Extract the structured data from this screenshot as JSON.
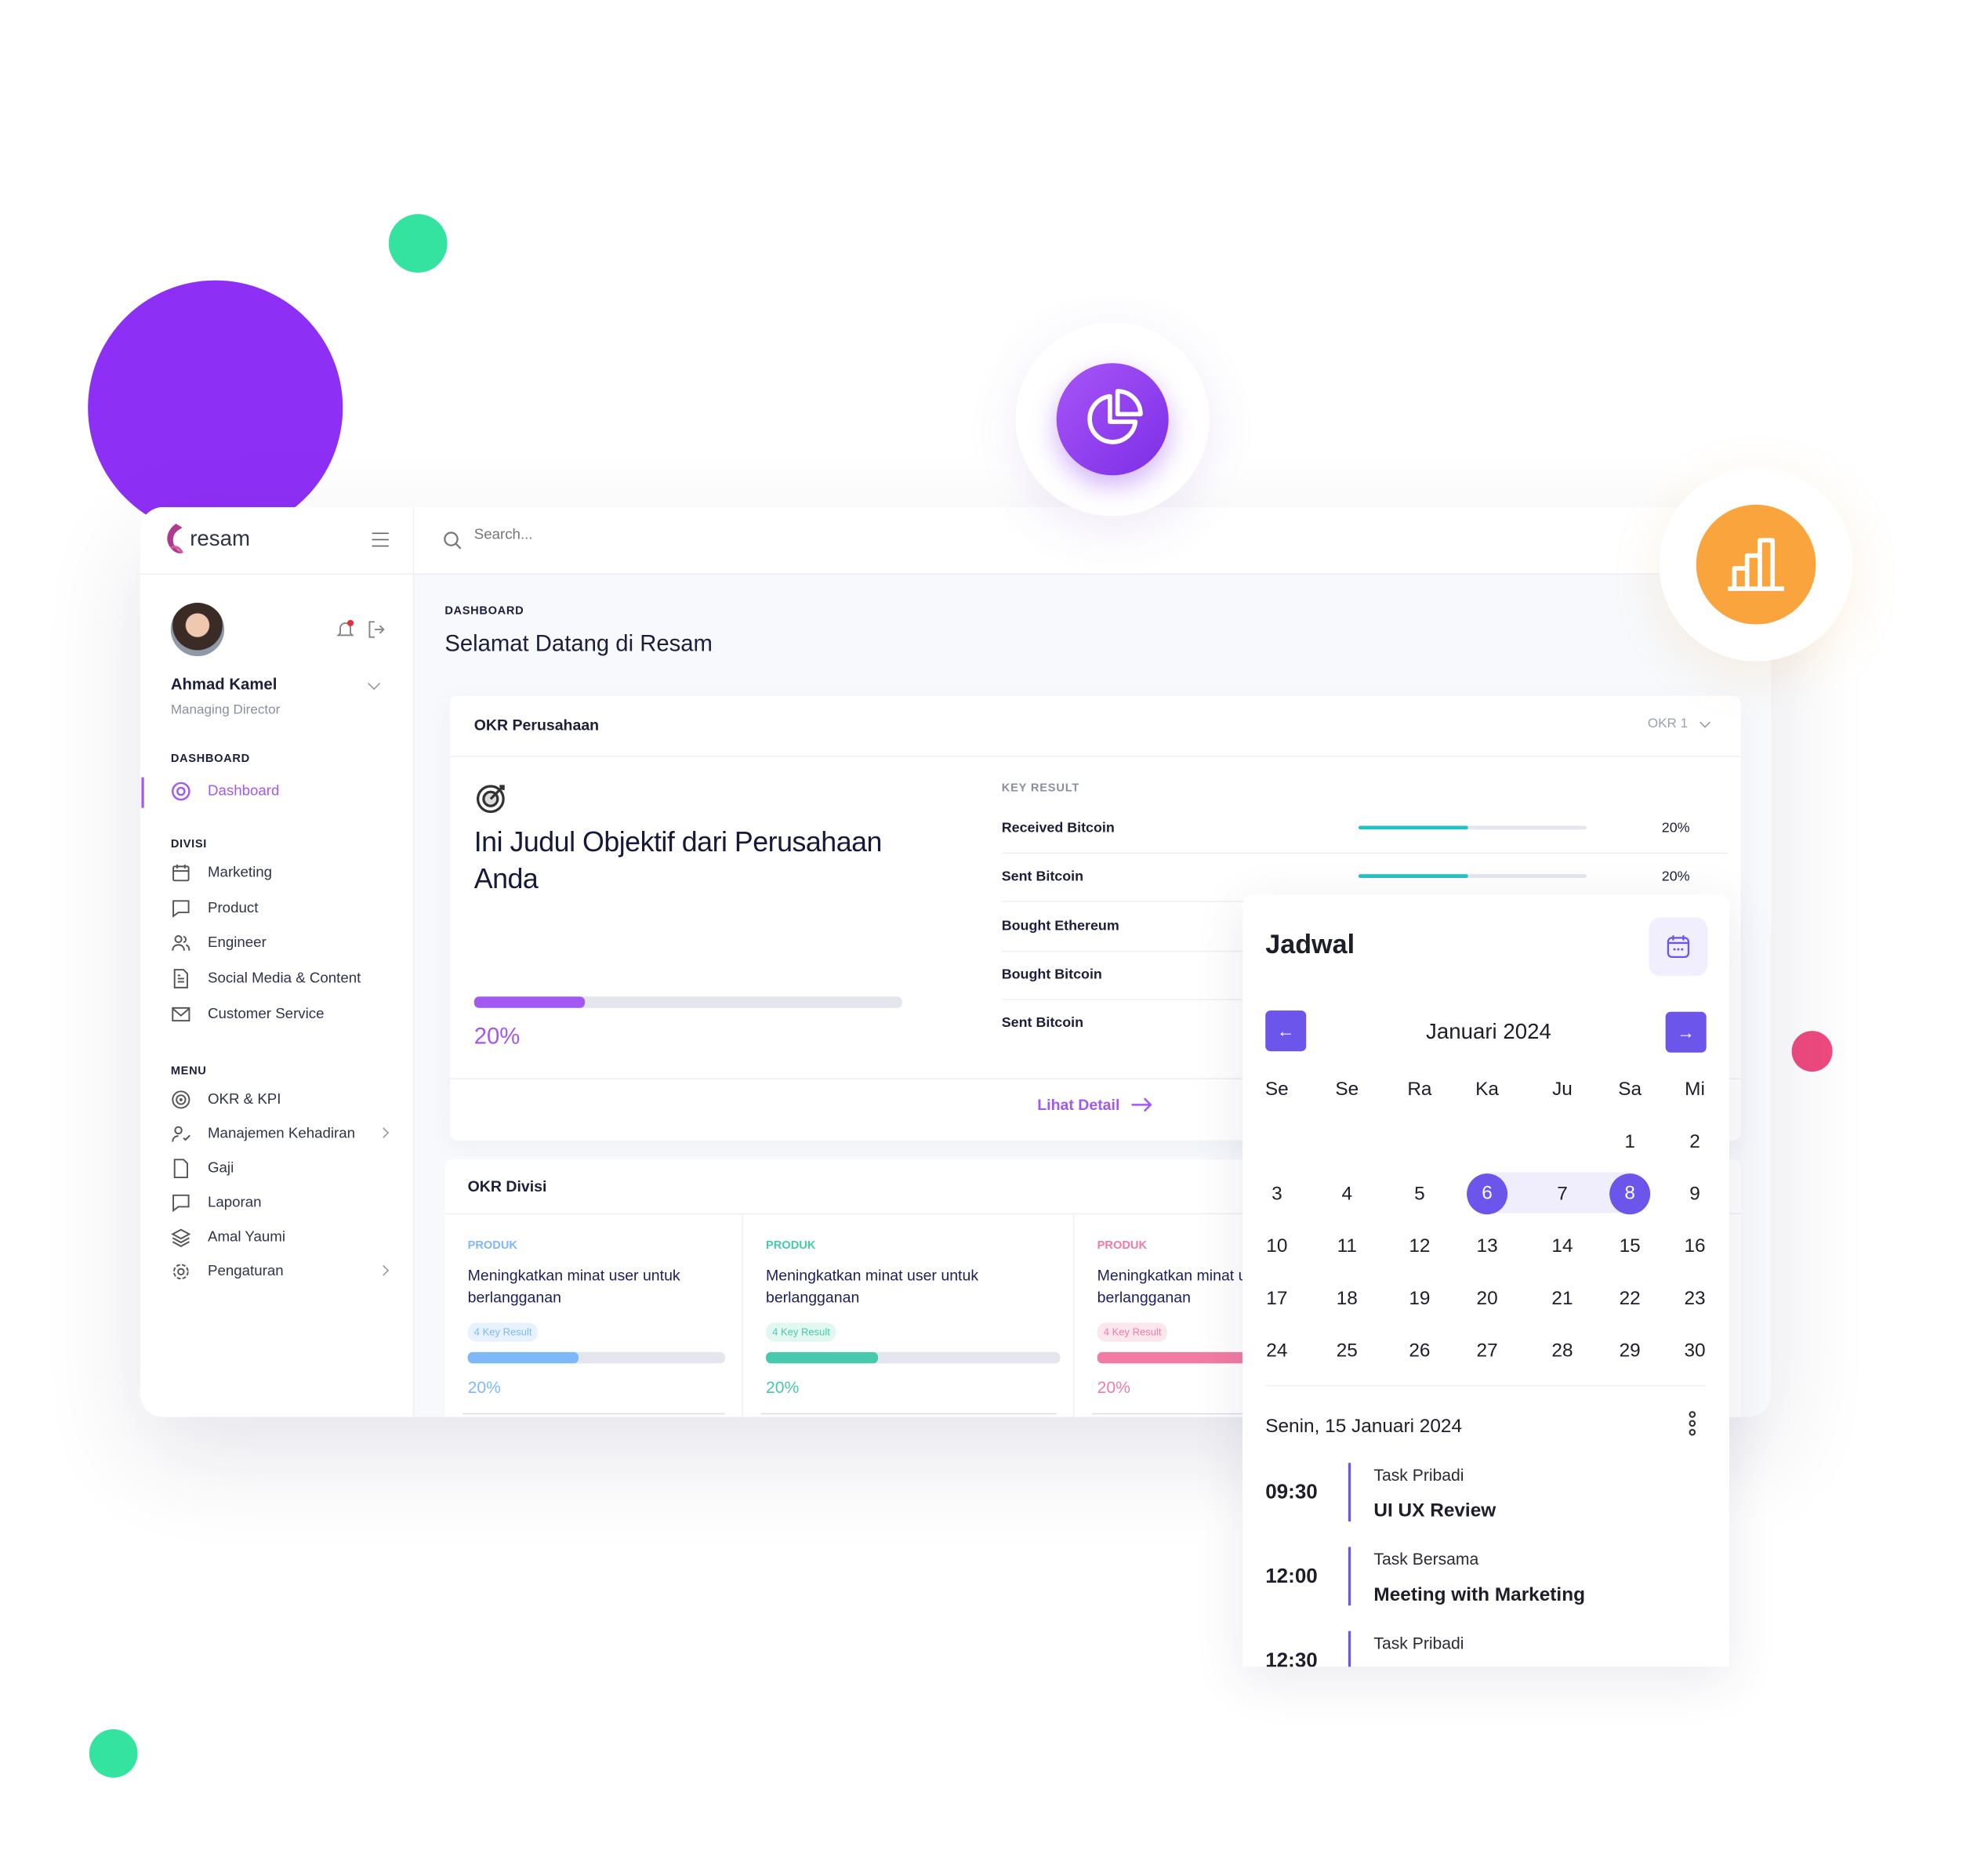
{
  "colors": {
    "purple": "#8e2ff5",
    "green": "#34e3a0",
    "pink": "#ef4a7f",
    "orange": "#f9a43d",
    "accent": "#6b55ea",
    "brand": "#a259f0"
  },
  "header": {
    "logo": "resam",
    "search_placeholder": "Search..."
  },
  "user": {
    "name": "Ahmad Kamel",
    "role": "Managing Director"
  },
  "sidebar": {
    "dashboard_section": "DASHBOARD",
    "dashboard_item": "Dashboard",
    "divisi_section": "DIVISI",
    "divisi": [
      {
        "label": "Marketing",
        "icon": "calendar-icon"
      },
      {
        "label": "Product",
        "icon": "chat-icon"
      },
      {
        "label": "Engineer",
        "icon": "users-icon"
      },
      {
        "label": "Social Media & Content",
        "icon": "document-icon"
      },
      {
        "label": "Customer Service",
        "icon": "mail-icon"
      }
    ],
    "menu_section": "MENU",
    "menu": [
      {
        "label": "OKR & KPI",
        "icon": "target-icon"
      },
      {
        "label": "Manajemen Kehadiran",
        "icon": "user-check-icon",
        "chevron": true
      },
      {
        "label": "Gaji",
        "icon": "file-icon"
      },
      {
        "label": "Laporan",
        "icon": "chat-icon"
      },
      {
        "label": "Amal Yaumi",
        "icon": "layers-icon"
      },
      {
        "label": "Pengaturan",
        "icon": "gear-icon",
        "chevron": true
      }
    ]
  },
  "page": {
    "breadcrumb": "DASHBOARD",
    "title": "Selamat Datang di Resam"
  },
  "okr_company": {
    "title": "OKR Perusahaan",
    "selector": "OKR 1",
    "objective": "Ini Judul Objektif dari Perusahaan Anda",
    "progress_label": "20%",
    "progress_fill": 0.26,
    "key_result_header": "KEY RESULT",
    "key_results": [
      {
        "label": "Received Bitcoin",
        "percent": "20%",
        "fill": 0.48
      },
      {
        "label": "Sent Bitcoin",
        "percent": "20%",
        "fill": 0.48
      },
      {
        "label": "Bought Ethereum"
      },
      {
        "label": "Bought Bitcoin"
      },
      {
        "label": "Sent Bitcoin"
      }
    ],
    "detail_link": "Lihat Detail"
  },
  "okr_division": {
    "title": "OKR Divisi",
    "cards": [
      {
        "tag": "PRODUK",
        "title": "Meningkatkan minat user untuk berlangganan",
        "badge": "4 Key Result",
        "percent": "20%",
        "fill": 0.43,
        "color": "#7db8fb",
        "bg": "#e8f2fe"
      },
      {
        "tag": "PRODUK",
        "title": "Meningkatkan minat user untuk berlangganan",
        "badge": "4 Key Result",
        "percent": "20%",
        "fill": 0.38,
        "color": "#46c9ac",
        "bg": "#e3f7f1"
      },
      {
        "tag": "PRODUK",
        "title": "Meningkatkan minat user untuk berlangganan",
        "badge": "4 Key Result",
        "percent": "20%",
        "fill": 0.7,
        "color": "#f27ba3",
        "bg": "#fde7ef"
      }
    ]
  },
  "schedule": {
    "title": "Jadwal",
    "month": "Januari 2024",
    "weekdays": [
      "Se",
      "Se",
      "Ra",
      "Ka",
      "Ju",
      "Sa",
      "Mi"
    ],
    "weeks": [
      [
        "",
        "",
        "",
        "",
        "",
        "1",
        "2"
      ],
      [
        "3",
        "4",
        "5",
        "6",
        "7",
        "8",
        "9"
      ],
      [
        "10",
        "11",
        "12",
        "13",
        "14",
        "15",
        "16"
      ],
      [
        "17",
        "18",
        "19",
        "20",
        "21",
        "22",
        "23"
      ],
      [
        "24",
        "25",
        "26",
        "27",
        "28",
        "29",
        "30"
      ]
    ],
    "range_start": "6",
    "range_end": "8",
    "selected_date": "Senin, 15 Januari 2024",
    "events": [
      {
        "time": "09:30",
        "category": "Task Pribadi",
        "title": "UI UX Review"
      },
      {
        "time": "12:00",
        "category": "Task Bersama",
        "title": "Meeting with Marketing"
      },
      {
        "time": "12:30",
        "category": "Task Pribadi",
        "title": ""
      }
    ]
  }
}
